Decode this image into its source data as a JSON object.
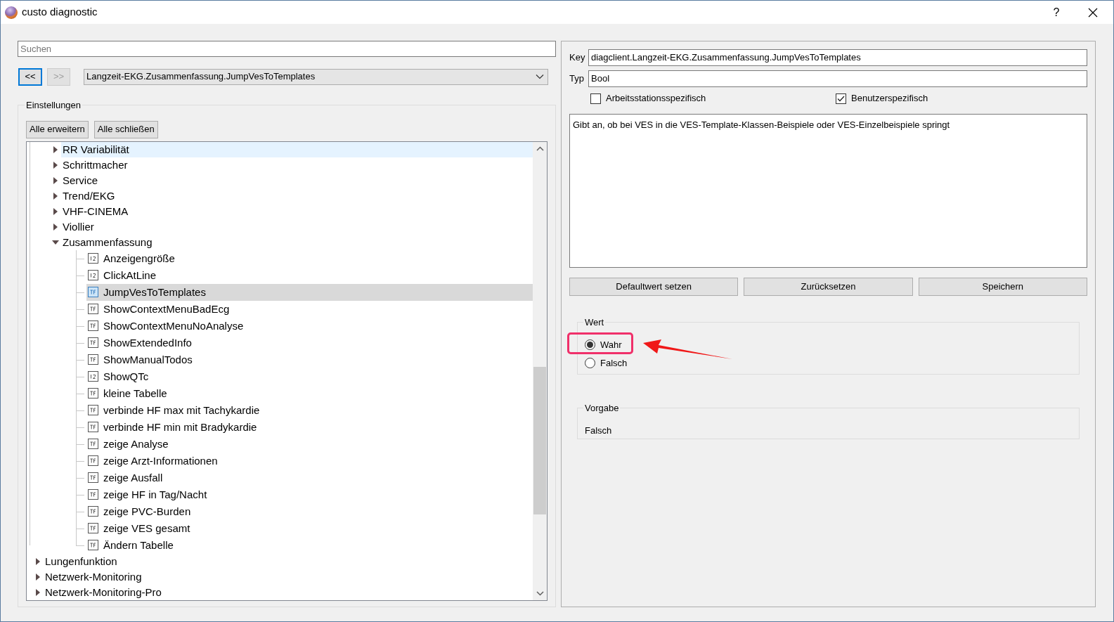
{
  "window": {
    "title": "custo diagnostic",
    "help": "?"
  },
  "search": {
    "placeholder": "Suchen"
  },
  "nav": {
    "back": "<<",
    "forward": ">>",
    "back_disabled": false,
    "forward_disabled": true,
    "path": "Langzeit-EKG.Zusammenfassung.JumpVesToTemplates"
  },
  "settings": {
    "title": "Einstellungen",
    "buttons": [
      "Alle erweitern",
      "Alle schließen"
    ],
    "tree": [
      {
        "kind": "continued",
        "expanded": true,
        "children": [
          {
            "kind": "folder",
            "label": "RR Variabilität",
            "expanded": false,
            "selected": false,
            "hovered": true
          },
          {
            "kind": "folder",
            "label": "Schrittmacher",
            "expanded": false,
            "selected": false,
            "hovered": false
          },
          {
            "kind": "folder",
            "label": "Service",
            "expanded": false,
            "selected": false,
            "hovered": false
          },
          {
            "kind": "folder",
            "label": "Trend/EKG",
            "expanded": false,
            "selected": false,
            "hovered": false
          },
          {
            "kind": "folder",
            "label": "VHF-CINEMA",
            "expanded": false,
            "selected": false,
            "hovered": false
          },
          {
            "kind": "folder",
            "label": "Viollier",
            "expanded": false,
            "selected": false,
            "hovered": false
          },
          {
            "kind": "folder",
            "label": "Zusammenfassung",
            "expanded": true,
            "selected": false,
            "hovered": false,
            "children": [
              {
                "kind": "int",
                "label": "Anzeigengröße",
                "selected": false,
                "hovered": false
              },
              {
                "kind": "int",
                "label": "ClickAtLine",
                "selected": false,
                "hovered": false
              },
              {
                "kind": "bool",
                "label": "JumpVesToTemplates",
                "selected": true,
                "hovered": false
              },
              {
                "kind": "bool",
                "label": "ShowContextMenuBadEcg",
                "selected": false,
                "hovered": false
              },
              {
                "kind": "bool",
                "label": "ShowContextMenuNoAnalyse",
                "selected": false,
                "hovered": false
              },
              {
                "kind": "bool",
                "label": "ShowExtendedInfo",
                "selected": false,
                "hovered": false
              },
              {
                "kind": "bool",
                "label": "ShowManualTodos",
                "selected": false,
                "hovered": false
              },
              {
                "kind": "int",
                "label": "ShowQTc",
                "selected": false,
                "hovered": false
              },
              {
                "kind": "bool",
                "label": "kleine Tabelle",
                "selected": false,
                "hovered": false
              },
              {
                "kind": "bool",
                "label": "verbinde HF max mit Tachykardie",
                "selected": false,
                "hovered": false
              },
              {
                "kind": "bool",
                "label": "verbinde HF min mit Bradykardie",
                "selected": false,
                "hovered": false
              },
              {
                "kind": "bool",
                "label": "zeige Analyse",
                "selected": false,
                "hovered": false
              },
              {
                "kind": "bool",
                "label": "zeige Arzt-Informationen",
                "selected": false,
                "hovered": false
              },
              {
                "kind": "bool",
                "label": "zeige Ausfall",
                "selected": false,
                "hovered": false
              },
              {
                "kind": "bool",
                "label": "zeige HF in Tag/Nacht",
                "selected": false,
                "hovered": false
              },
              {
                "kind": "bool",
                "label": "zeige PVC-Burden",
                "selected": false,
                "hovered": false
              },
              {
                "kind": "bool",
                "label": "zeige VES gesamt",
                "selected": false,
                "hovered": false
              },
              {
                "kind": "bool",
                "label": "Ändern Tabelle",
                "selected": false,
                "hovered": false
              }
            ]
          }
        ]
      },
      {
        "kind": "folder",
        "label": "Lungenfunktion",
        "expanded": false,
        "selected": false,
        "hovered": false
      },
      {
        "kind": "folder",
        "label": "Netzwerk-Monitoring",
        "expanded": false,
        "selected": false,
        "hovered": false
      },
      {
        "kind": "folder",
        "label": "Netzwerk-Monitoring-Pro",
        "expanded": false,
        "selected": false,
        "hovered": false
      }
    ]
  },
  "detail": {
    "key_label": "Key",
    "key": "diagclient.Langzeit-EKG.Zusammenfassung.JumpVesToTemplates",
    "type_label": "Typ",
    "type": "Bool",
    "checkboxes": [
      {
        "label": "Arbeitsstationsspezifisch",
        "checked": false
      },
      {
        "label": "Benutzerspezifisch",
        "checked": true
      }
    ],
    "description": "Gibt an, ob bei VES in die VES-Template-Klassen-Beispiele oder VES-Einzelbeispiele springt",
    "buttons": [
      "Defaultwert setzen",
      "Zurücksetzen",
      "Speichern"
    ],
    "value": {
      "title": "Wert",
      "options": [
        {
          "label": "Wahr",
          "selected": true
        },
        {
          "label": "Falsch",
          "selected": false
        }
      ]
    },
    "default": {
      "title": "Vorgabe",
      "value": "Falsch"
    }
  }
}
